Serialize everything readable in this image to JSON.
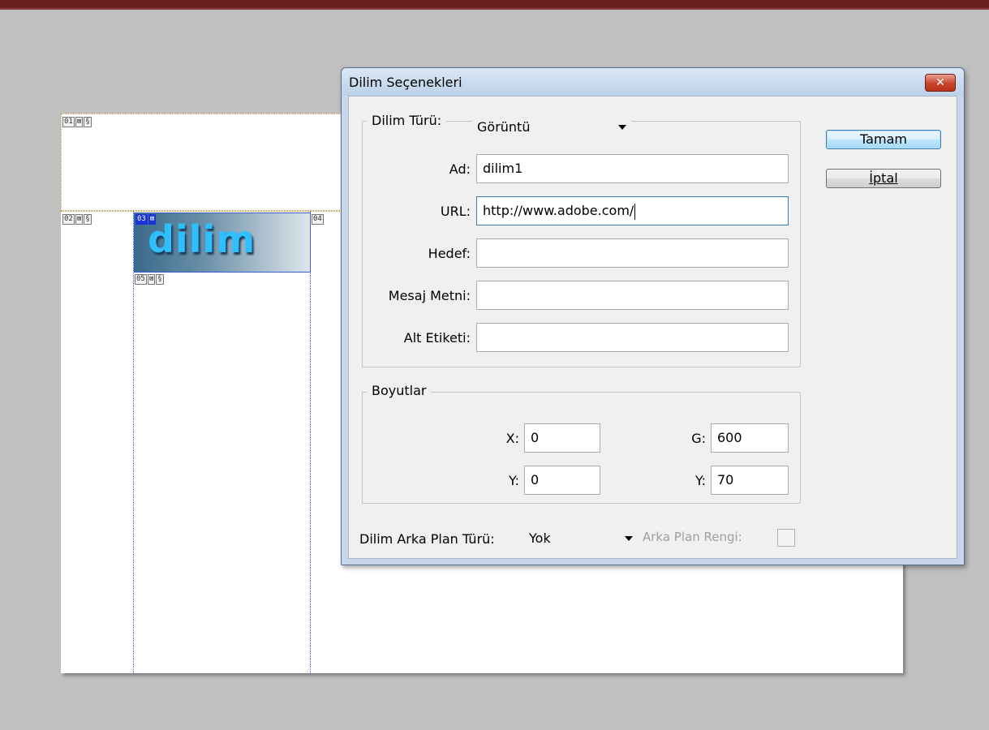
{
  "dialog": {
    "title": "Dilim Seçenekleri",
    "close_symbol": "✕",
    "ok_label": "Tamam",
    "cancel_label": "İptal",
    "slice_type": {
      "label": "Dilim Türü:",
      "value": "Görüntü"
    },
    "fields": {
      "name": {
        "label": "Ad:",
        "value": "dilim1"
      },
      "url": {
        "label": "URL:",
        "value": "http://www.adobe.com/"
      },
      "target": {
        "label": "Hedef:",
        "value": ""
      },
      "message": {
        "label": "Mesaj Metni:",
        "value": ""
      },
      "alt": {
        "label": "Alt Etiketi:",
        "value": ""
      }
    },
    "dimensions": {
      "legend": "Boyutlar",
      "x": {
        "label": "X:",
        "value": "0"
      },
      "y": {
        "label": "Y:",
        "value": "0"
      },
      "w": {
        "label": "G:",
        "value": "600"
      },
      "h": {
        "label": "Y:",
        "value": "70"
      }
    },
    "background": {
      "type_label": "Dilim Arka Plan Türü:",
      "type_value": "Yok",
      "color_label": "Arka Plan Rengi:"
    }
  },
  "canvas": {
    "slice_labels": [
      "01",
      "02",
      "03",
      "04",
      "05"
    ],
    "slice_text": "dilim"
  },
  "colors": {
    "selected_slice": "#1a33d6",
    "slice_text": "#2fbfff",
    "top_bar": "#6b1f1f"
  }
}
